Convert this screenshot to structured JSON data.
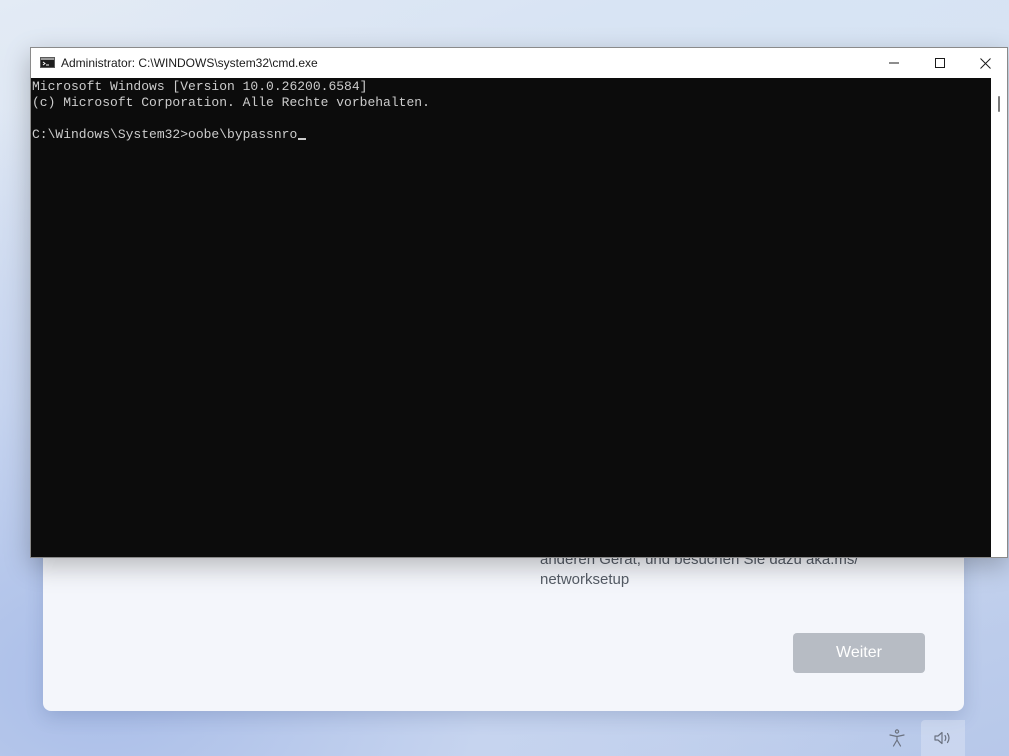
{
  "oobe": {
    "text_lines": [
      "anderen Gerät, und besuchen Sie dazu aka.ms/",
      "networksetup"
    ],
    "next_label": "Weiter"
  },
  "cmd": {
    "title": "Administrator: C:\\WINDOWS\\system32\\cmd.exe",
    "lines": [
      "Microsoft Windows [Version 10.0.26200.6584]",
      "(c) Microsoft Corporation. Alle Rechte vorbehalten.",
      "",
      "C:\\Windows\\System32>oobe\\bypassnro"
    ]
  },
  "icons": {
    "app": "cmd-icon",
    "minimize": "minimize-icon",
    "maximize": "maximize-icon",
    "close": "close-icon",
    "accessibility": "accessibility-icon",
    "volume": "volume-icon"
  },
  "colors": {
    "console_bg": "#0c0c0c",
    "console_text": "#cccccc",
    "button_disabled": "#b7bcc4"
  }
}
